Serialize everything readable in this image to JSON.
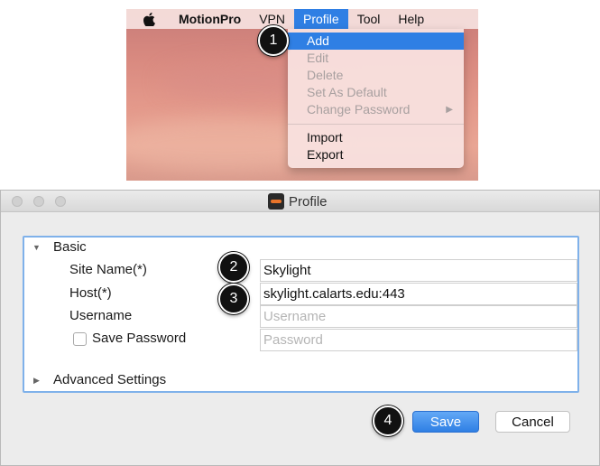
{
  "menubar": {
    "app_name": "MotionPro",
    "items": [
      "VPN",
      "Profile",
      "Tool",
      "Help"
    ],
    "active_item": "Profile"
  },
  "profile_menu": {
    "items": [
      "Add",
      "Edit",
      "Delete",
      "Set As Default",
      "Change Password"
    ],
    "items_group2": [
      "Import",
      "Export"
    ],
    "highlighted": "Add",
    "disabled": [
      "Edit",
      "Delete",
      "Set As Default",
      "Change Password"
    ]
  },
  "dialog": {
    "title": "Profile",
    "basic_section": "Basic",
    "advanced_section": "Advanced Settings",
    "site_name_label": "Site Name(*)",
    "site_name_value": "Skylight",
    "host_label": "Host(*)",
    "host_value": "skylight.calarts.edu:443",
    "username_label": "Username",
    "username_placeholder": "Username",
    "save_password_label": "Save Password",
    "password_placeholder": "Password",
    "save_label": "Save",
    "cancel_label": "Cancel"
  },
  "callouts": [
    "1",
    "2",
    "3",
    "4"
  ],
  "colors": {
    "accent": "#2f7fe4",
    "panel_border": "#7fb1ea"
  }
}
